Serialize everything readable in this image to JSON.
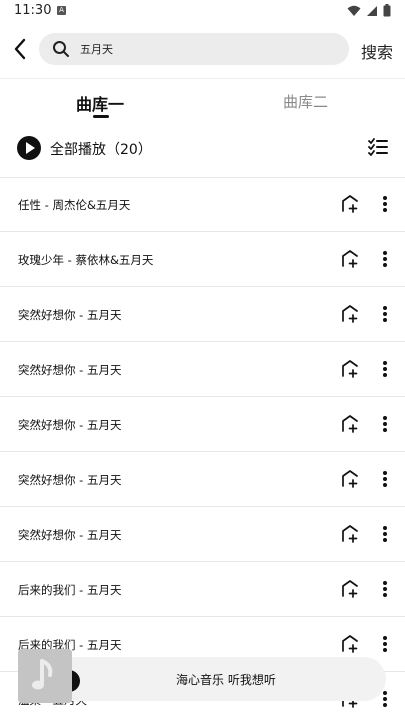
{
  "status_bar": {
    "time": "11:30",
    "notification_icon": "a-icon",
    "icons": [
      "wifi-icon",
      "signal-icon",
      "battery-icon"
    ]
  },
  "search": {
    "query": "五月天",
    "action_label": "搜索"
  },
  "tabs": [
    {
      "label": "曲库一",
      "active": true
    },
    {
      "label": "曲库二",
      "active": false
    }
  ],
  "play_all": {
    "label": "全部播放（20）"
  },
  "songs": [
    {
      "title": "任性 - 周杰伦&五月天"
    },
    {
      "title": "玫瑰少年 - 蔡依林&五月天"
    },
    {
      "title": "突然好想你 - 五月天"
    },
    {
      "title": "突然好想你 - 五月天"
    },
    {
      "title": "突然好想你 - 五月天"
    },
    {
      "title": "突然好想你 - 五月天"
    },
    {
      "title": "突然好想你 - 五月天"
    },
    {
      "title": "后来的我们 - 五月天"
    },
    {
      "title": "后来的我们 - 五月天"
    },
    {
      "title": "温柔 - 五月天"
    }
  ],
  "mini_player": {
    "title": "海心音乐 听我想听"
  },
  "colors": {
    "accent": "#111111",
    "tab_inactive": "#8a8a8a",
    "search_bg": "#ececec",
    "player_bg": "#f2f2f2"
  }
}
